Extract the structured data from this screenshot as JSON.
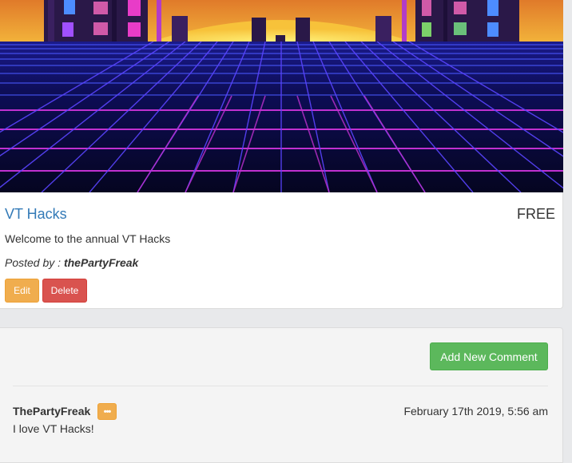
{
  "event": {
    "title": "VT Hacks",
    "price": "FREE",
    "description": "Welcome to the annual VT Hacks",
    "posted_by_label": "Posted by : ",
    "author": "thePartyFreak",
    "edit_label": "Edit",
    "delete_label": "Delete"
  },
  "comments": {
    "add_label": "Add New Comment",
    "items": [
      {
        "author": "ThePartyFreak",
        "menu_icon": "•••",
        "date": "February 17th 2019, 5:56 am",
        "text": "I love VT Hacks!"
      }
    ]
  },
  "colors": {
    "link": "#337ab7",
    "edit": "#f0ad4e",
    "delete": "#d9534f",
    "add": "#5cb85c"
  }
}
